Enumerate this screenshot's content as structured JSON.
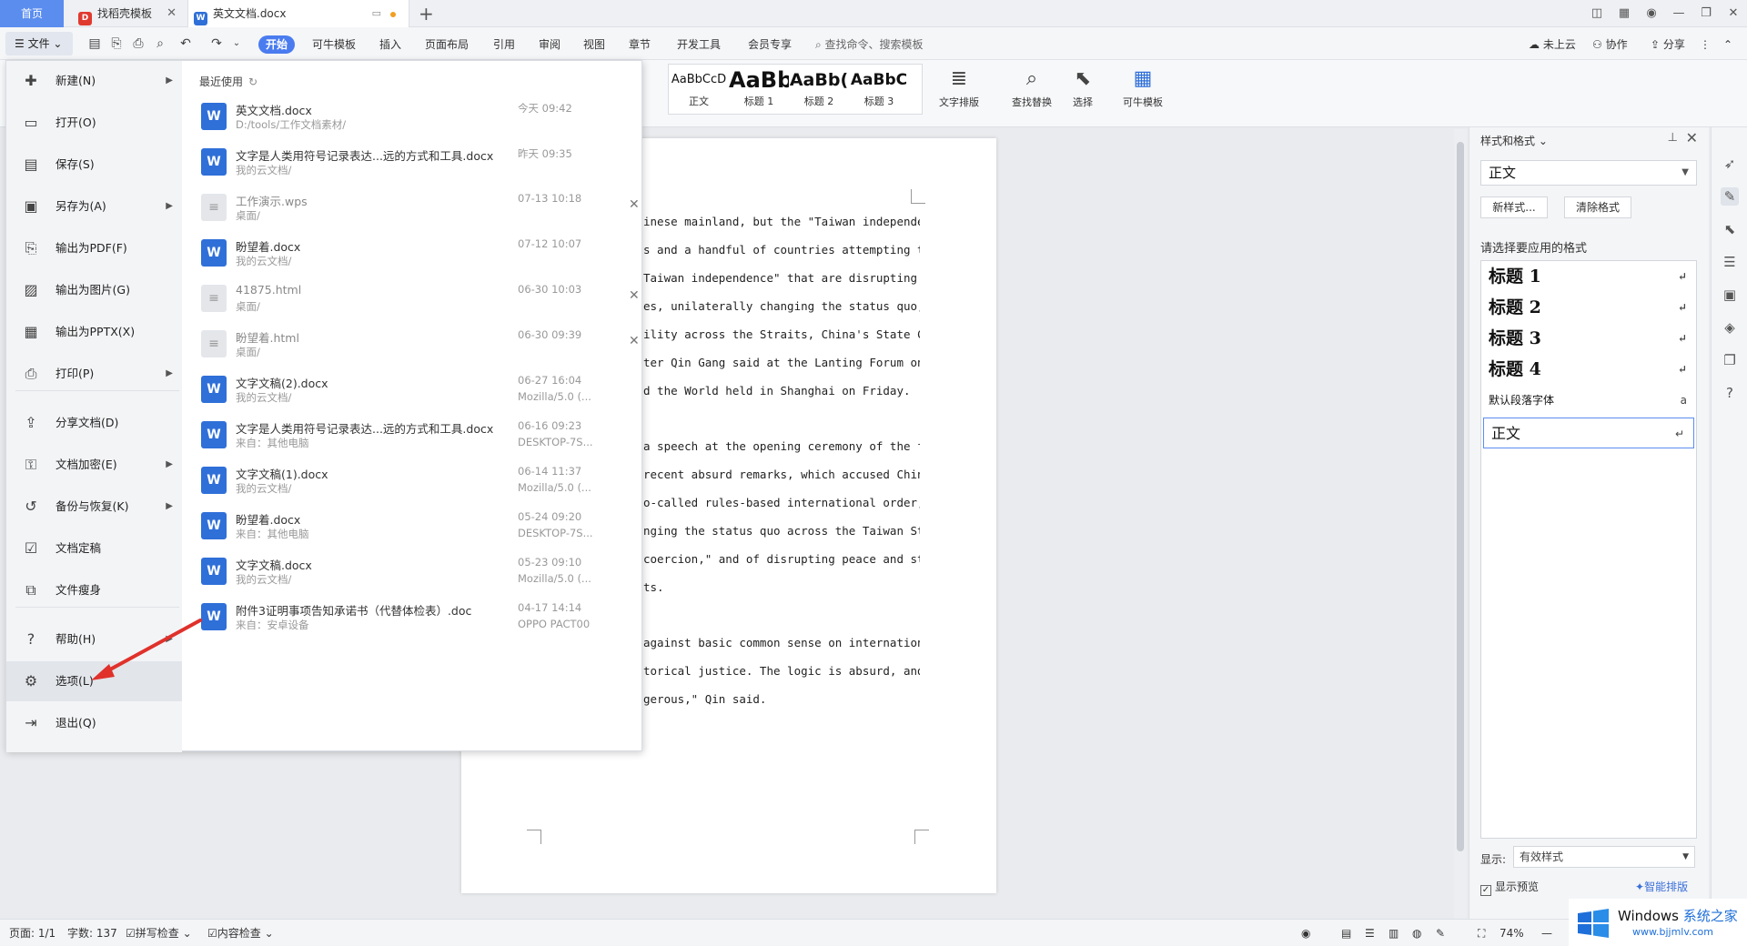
{
  "tabs": {
    "home": "首页",
    "tab1": "找稻壳模板",
    "tab2": "英文文档.docx"
  },
  "menubar": {
    "file": "文件",
    "tabs": [
      "开始",
      "可牛模板",
      "插入",
      "页面布局",
      "引用",
      "审阅",
      "视图",
      "章节",
      "开发工具",
      "会员专享"
    ],
    "search": "查找命令、搜索模板",
    "cloud": "未上云",
    "collab": "协作",
    "share": "分享"
  },
  "ribbon": {
    "styles": [
      {
        "preview": "AaBbCcD",
        "label": "正文"
      },
      {
        "preview": "AaBb",
        "label": "标题 1"
      },
      {
        "preview": "AaBb(",
        "label": "标题 2"
      },
      {
        "preview": "AaBbC",
        "label": "标题 3"
      }
    ],
    "text_layout": "文字排版",
    "find_replace": "查找替换",
    "select": "选择",
    "kn_template": "可牛模板"
  },
  "file_menu": {
    "items": [
      {
        "label": "新建(N)",
        "icon": "new-icon",
        "submenu": true
      },
      {
        "label": "打开(O)",
        "icon": "open-folder-icon",
        "submenu": false
      },
      {
        "label": "保存(S)",
        "icon": "save-icon",
        "submenu": false
      },
      {
        "label": "另存为(A)",
        "icon": "save-as-icon",
        "submenu": true
      },
      {
        "label": "输出为PDF(F)",
        "icon": "pdf-icon",
        "submenu": false
      },
      {
        "label": "输出为图片(G)",
        "icon": "image-icon",
        "submenu": false
      },
      {
        "label": "输出为PPTX(X)",
        "icon": "pptx-icon",
        "submenu": false
      },
      {
        "label": "打印(P)",
        "icon": "print-icon",
        "submenu": true
      },
      {
        "label": "分享文档(D)",
        "icon": "share-icon",
        "submenu": false
      },
      {
        "label": "文档加密(E)",
        "icon": "lock-icon",
        "submenu": true
      },
      {
        "label": "备份与恢复(K)",
        "icon": "backup-icon",
        "submenu": true
      },
      {
        "label": "文档定稿",
        "icon": "finalize-icon",
        "submenu": false
      },
      {
        "label": "文件瘦身",
        "icon": "slim-icon",
        "submenu": false
      },
      {
        "label": "帮助(H)",
        "icon": "help-icon",
        "submenu": true
      },
      {
        "label": "选项(L)",
        "icon": "gear-icon",
        "submenu": false
      },
      {
        "label": "退出(Q)",
        "icon": "exit-icon",
        "submenu": false
      }
    ]
  },
  "recent": {
    "title": "最近使用",
    "files": [
      {
        "name": "英文文档.docx",
        "path": "D:/tools/工作文档素材/",
        "time": "今天  09:42",
        "source": "",
        "type": "w"
      },
      {
        "name": "文字是人类用符号记录表达...远的方式和工具.docx",
        "path": "我的云文档/",
        "time": "昨天  09:35",
        "source": "",
        "type": "w"
      },
      {
        "name": "工作演示.wps",
        "path": "桌面/",
        "time": "07-13  10:18",
        "source": "",
        "type": "g"
      },
      {
        "name": "盼望着.docx",
        "path": "我的云文档/",
        "time": "07-12  10:07",
        "source": "",
        "type": "w"
      },
      {
        "name": "41875.html",
        "path": "桌面/",
        "time": "06-30  10:03",
        "source": "",
        "type": "g"
      },
      {
        "name": "盼望着.html",
        "path": "桌面/",
        "time": "06-30  09:39",
        "source": "",
        "type": "g"
      },
      {
        "name": "文字文稿(2).docx",
        "path": "我的云文档/",
        "time": "06-27  16:04",
        "source": "Mozilla/5.0 (...",
        "type": "w"
      },
      {
        "name": "文字是人类用符号记录表达...远的方式和工具.docx",
        "path": "来自：其他电脑",
        "time": "06-16  09:23",
        "source": "DESKTOP-7S...",
        "type": "w"
      },
      {
        "name": "文字文稿(1).docx",
        "path": "我的云文档/",
        "time": "06-14  11:37",
        "source": "Mozilla/5.0 (...",
        "type": "w"
      },
      {
        "name": "盼望着.docx",
        "path": "来自：其他电脑",
        "time": "05-24  09:20",
        "source": "DESKTOP-7S...",
        "type": "w"
      },
      {
        "name": "文字文稿.docx",
        "path": "我的云文档/",
        "time": "05-23  09:10",
        "source": "Mozilla/5.0 (...",
        "type": "w"
      },
      {
        "name": "附件3证明事项告知承诺书（代替体检表）.doc",
        "path": "来自：安卓设备",
        "time": "04-17  14:14",
        "source": "OPPO PACT00",
        "type": "w"
      }
    ]
  },
  "document": {
    "lines": [
      "inese mainland, but the \"Taiwan independence\"",
      "s and a handful of countries attempting to take",
      "Taiwan  independence\"  that  are  disrupting",
      "es, unilaterally changing the status quo, and",
      "ility across the Straits, China's State Councilor",
      "ter Qin Gang said at the Lanting Forum on Chinese",
      "d the World held in Shanghai on Friday.",
      "",
      "a speech at the opening ceremony of the forum,",
      "recent absurd remarks, which accused China of",
      "o-called rules-based international order,\" of",
      "nging the status quo across the Taiwan Straits",
      "coercion,\" and of disrupting peace and stability",
      "ts.",
      "",
      "against basic common sense on international",
      "torical justice. The logic is absurd, and the",
      "gerous,\" Qin said."
    ]
  },
  "styles_panel": {
    "title": "样式和格式",
    "current": "正文",
    "new_style": "新样式...",
    "clear_format": "清除格式",
    "prompt": "请选择要应用的格式",
    "items": [
      {
        "label": "标题  1",
        "kind": "h",
        "mark": "↵"
      },
      {
        "label": "标题  2",
        "kind": "h",
        "mark": "↵"
      },
      {
        "label": "标题  3",
        "kind": "h",
        "mark": "↵"
      },
      {
        "label": "标题  4",
        "kind": "h",
        "mark": "↵"
      },
      {
        "label": "默认段落字体",
        "kind": "small",
        "mark": "a"
      },
      {
        "label": "正文",
        "kind": "sel",
        "mark": "↵"
      }
    ],
    "show_label": "显示:",
    "show_value": "有效样式",
    "preview_label": "显示预览",
    "smart_layout": "智能排版"
  },
  "statusbar": {
    "page": "页面: 1/1",
    "words": "字数: 137",
    "spell": "拼写检查",
    "content": "内容检查",
    "zoom": "74%"
  },
  "watermark": {
    "title_a": "Windows",
    "title_b": "系统之家",
    "url": "www.bjjmlv.com"
  },
  "colors": {
    "accent": "#4a7cf0",
    "word_icon": "#2f6fd8",
    "arrow": "#e0312b"
  }
}
